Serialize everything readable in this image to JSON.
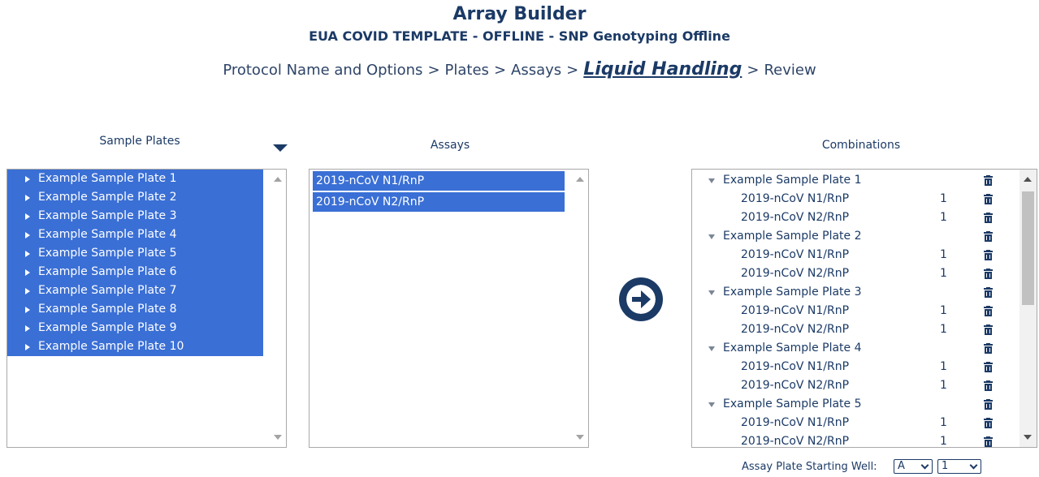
{
  "header": {
    "title": "Array Builder",
    "subtitle": "EUA COVID TEMPLATE - OFFLINE - SNP Genotyping Offline"
  },
  "breadcrumb": {
    "steps": [
      "Protocol Name and Options",
      "Plates",
      "Assays",
      "Liquid Handling",
      "Review"
    ],
    "separator": ">",
    "active_index": 3
  },
  "sample_plates": {
    "label": "Sample Plates",
    "items": [
      "Example Sample Plate 1",
      "Example Sample Plate 2",
      "Example Sample Plate 3",
      "Example Sample Plate 4",
      "Example Sample Plate 5",
      "Example Sample Plate 6",
      "Example Sample Plate 7",
      "Example Sample Plate 8",
      "Example Sample Plate 9",
      "Example Sample Plate 10"
    ]
  },
  "assays": {
    "label": "Assays",
    "items": [
      "2019-nCoV N1/RnP",
      "2019-nCoV N2/RnP"
    ]
  },
  "combinations": {
    "label": "Combinations",
    "groups": [
      {
        "plate": "Example Sample Plate 1",
        "assays": [
          {
            "name": "2019-nCoV N1/RnP",
            "count": "1"
          },
          {
            "name": "2019-nCoV N2/RnP",
            "count": "1"
          }
        ]
      },
      {
        "plate": "Example Sample Plate 2",
        "assays": [
          {
            "name": "2019-nCoV N1/RnP",
            "count": "1"
          },
          {
            "name": "2019-nCoV N2/RnP",
            "count": "1"
          }
        ]
      },
      {
        "plate": "Example Sample Plate 3",
        "assays": [
          {
            "name": "2019-nCoV N1/RnP",
            "count": "1"
          },
          {
            "name": "2019-nCoV N2/RnP",
            "count": "1"
          }
        ]
      },
      {
        "plate": "Example Sample Plate 4",
        "assays": [
          {
            "name": "2019-nCoV N1/RnP",
            "count": "1"
          },
          {
            "name": "2019-nCoV N2/RnP",
            "count": "1"
          }
        ]
      },
      {
        "plate": "Example Sample Plate 5",
        "assays": [
          {
            "name": "2019-nCoV N1/RnP",
            "count": "1"
          },
          {
            "name": "2019-nCoV N2/RnP",
            "count": "1"
          }
        ]
      }
    ]
  },
  "starting_well": {
    "label": "Assay Plate Starting Well:",
    "row_value": "A",
    "col_value": "1"
  },
  "icons": {
    "go": "arrow-right-circle-icon",
    "delete": "trash-icon",
    "expand": "triangle-right-icon",
    "collapse": "triangle-down-icon"
  },
  "colors": {
    "navy": "#1b3a66",
    "selection": "#3a6fd5"
  }
}
